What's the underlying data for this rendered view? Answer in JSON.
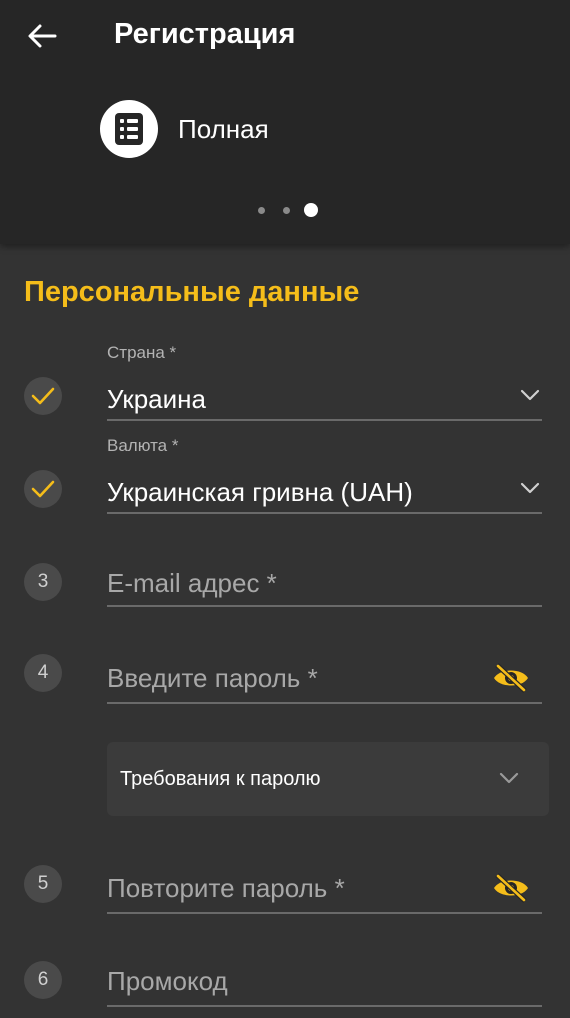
{
  "header": {
    "title": "Регистрация",
    "registration_type": "Полная",
    "pager": {
      "total": 3,
      "active": 3
    }
  },
  "form": {
    "section_title": "Персональные данные",
    "country": {
      "label": "Страна *",
      "value": "Украина",
      "status": "done"
    },
    "currency": {
      "label": "Валюта *",
      "value": "Украинская гривна (UAH)",
      "status": "done"
    },
    "email": {
      "step": "3",
      "placeholder": "E-mail адрес *"
    },
    "password": {
      "step": "4",
      "placeholder": "Введите пароль *"
    },
    "password_requirements": {
      "label": "Требования к паролю"
    },
    "password_repeat": {
      "step": "5",
      "placeholder": "Повторите пароль *"
    },
    "promo": {
      "step": "6",
      "placeholder": "Промокод"
    }
  },
  "colors": {
    "accent": "#f5bd1a",
    "header_bg": "#262626",
    "page_bg": "#333333",
    "step_bg": "#4a4a4a"
  },
  "icons": {
    "back": "arrow-left-icon",
    "registration_type": "list-icon",
    "done": "check-icon",
    "dropdown": "chevron-down-icon",
    "visibility": "eye-off-icon"
  }
}
